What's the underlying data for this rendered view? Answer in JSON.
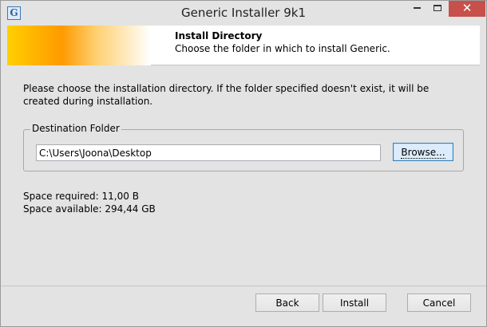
{
  "window": {
    "title": "Generic Installer 9k1",
    "icon_glyph": "G",
    "controls": [
      "minimize-icon",
      "maximize-icon",
      "close-icon"
    ],
    "close_glyph": "✕"
  },
  "header": {
    "title": "Install Directory",
    "subtitle": "Choose the folder in which to install Generic."
  },
  "body": {
    "description": "Please choose the installation directory. If the folder specified doesn't exist, it will be created during installation.",
    "destination": {
      "legend": "Destination Folder",
      "path": "C:\\Users\\Joona\\Desktop",
      "browse_label": "Browse..."
    },
    "space_required": "Space required:  11,00 B",
    "space_available": "Space available:  294,44 GB"
  },
  "footer": {
    "back_label": "Back",
    "install_label": "Install",
    "cancel_label": "Cancel"
  },
  "colors": {
    "close_button": "#c7504a",
    "banner_gradient_start": "#ffd000",
    "banner_gradient_mid": "#ff9a00",
    "focus_button_border": "#3c7fb1"
  }
}
